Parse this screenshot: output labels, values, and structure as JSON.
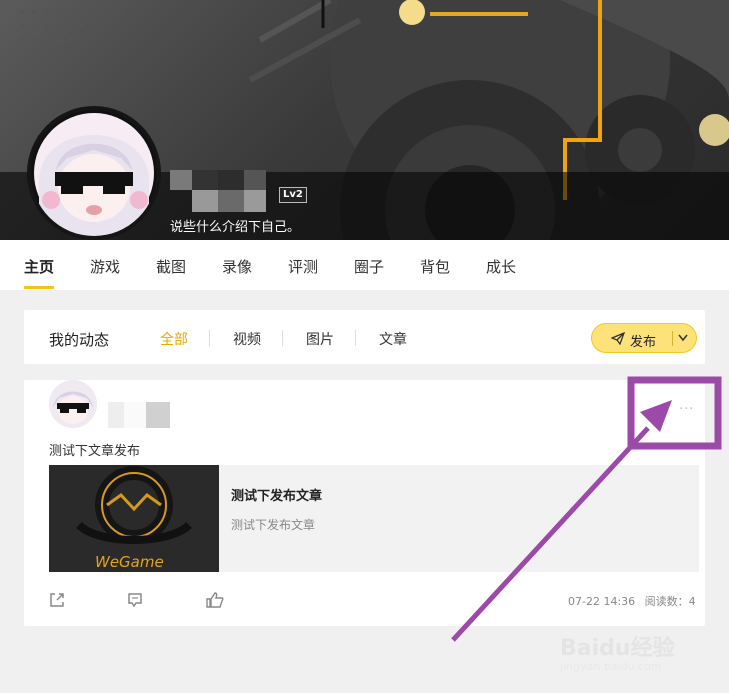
{
  "profile": {
    "level": "Lv2",
    "bio": "说些什么介绍下自己。"
  },
  "nav": {
    "tabs": [
      {
        "label": "主页",
        "active": true
      },
      {
        "label": "游戏"
      },
      {
        "label": "截图"
      },
      {
        "label": "录像"
      },
      {
        "label": "评测"
      },
      {
        "label": "圈子"
      },
      {
        "label": "背包"
      },
      {
        "label": "成长"
      }
    ]
  },
  "feed": {
    "title": "我的动态",
    "filters": [
      "全部",
      "视频",
      "图片",
      "文章"
    ],
    "active_filter": "全部",
    "publish_label": "发布"
  },
  "post": {
    "text": "测试下文章发布",
    "more_label": "···",
    "article": {
      "title": "测试下发布文章",
      "desc": "测试下发布文章",
      "thumb_logo": "WeGame"
    },
    "date": "07-22 14:36",
    "read_label": "阅读数：4"
  },
  "watermark": {
    "text": "Baidu经验",
    "sub": "jingyan.baidu.com"
  },
  "colors": {
    "accent": "#f4c418",
    "annotation": "#9b4aa8"
  }
}
